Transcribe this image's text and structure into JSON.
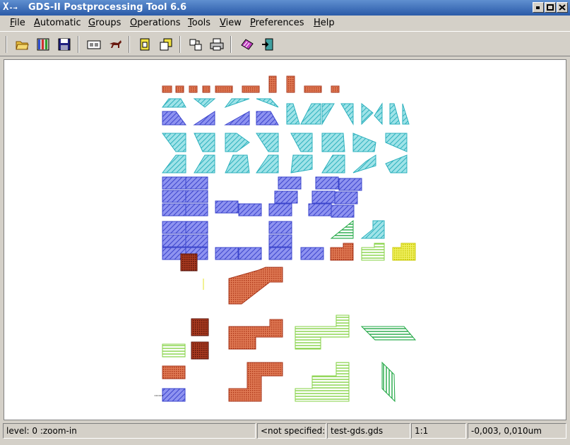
{
  "window": {
    "title": "GDS-II Postprocessing Tool 6.6",
    "logo": "X",
    "logo_mark": "-→"
  },
  "menu": [
    {
      "label": "File",
      "accel": "F",
      "rest": "ile"
    },
    {
      "label": "Automatic",
      "accel": "A",
      "rest": "utomatic"
    },
    {
      "label": "Groups",
      "accel": "G",
      "rest": "roups"
    },
    {
      "label": "Operations",
      "accel": "O",
      "rest": "perations"
    },
    {
      "label": "Tools",
      "accel": "T",
      "rest": "ools"
    },
    {
      "label": "View",
      "accel": "V",
      "rest": "iew"
    },
    {
      "label": "Preferences",
      "accel": "P",
      "rest": "references"
    },
    {
      "label": "Help",
      "accel": "H",
      "rest": "elp"
    }
  ],
  "toolbar": {
    "icons": [
      "open-folder-icon",
      "layer-bars-icon",
      "save-disk-icon",
      "film-strip-icon",
      "running-horse-icon",
      "paste-yellow-icon",
      "copy-yellow-icon",
      "transform-icon",
      "print-icon",
      "hatch-pattern-icon",
      "exit-icon"
    ]
  },
  "colors": {
    "brown": "#c8552d",
    "blue": "#4f59d8",
    "cyan": "#41c4d0",
    "green": "#2db84e",
    "lightgreen": "#8ad44a",
    "yellow": "#e6e62a",
    "darkbrown": "#8b2a1e"
  },
  "status": {
    "level": "level: 0 :zoom-in",
    "spec": "<not specified:",
    "file": "test-gds.gds",
    "scale": "1:1",
    "coords": "-0,003, 0,010um"
  }
}
